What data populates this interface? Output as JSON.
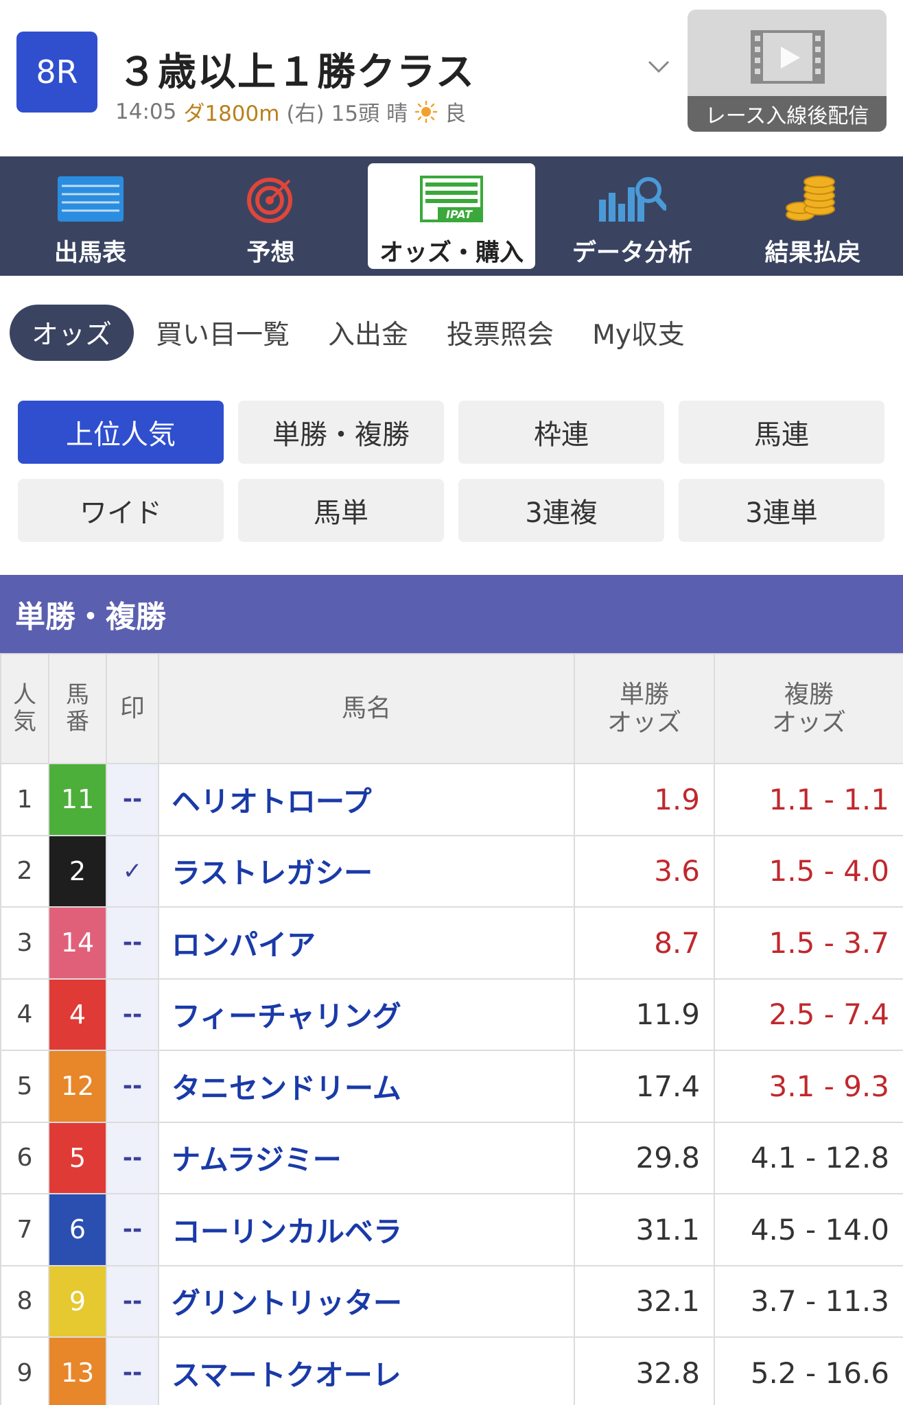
{
  "race": {
    "number": "8R",
    "title": "３歳以上１勝クラス",
    "time": "14:05",
    "track": "ダ1800m",
    "direction": "(右)",
    "runners": "15頭",
    "weather": "晴",
    "condition": "良"
  },
  "video": {
    "label": "レース入線後配信"
  },
  "main_nav": [
    {
      "label": "出馬表",
      "icon": "entry-list-icon"
    },
    {
      "label": "予想",
      "icon": "target-icon"
    },
    {
      "label": "オッズ・購入",
      "icon": "ipat-icon",
      "icon_text": "IPAT"
    },
    {
      "label": "データ分析",
      "icon": "chart-search-icon"
    },
    {
      "label": "結果払戻",
      "icon": "coins-icon"
    }
  ],
  "sub_nav": [
    "オッズ",
    "買い目一覧",
    "入出金",
    "投票照会",
    "My収支"
  ],
  "bet_types": [
    "上位人気",
    "単勝・複勝",
    "枠連",
    "馬連",
    "ワイド",
    "馬単",
    "3連複",
    "3連単"
  ],
  "section_title": "単勝・複勝",
  "table": {
    "headers": {
      "pop": [
        "人",
        "気"
      ],
      "num": [
        "馬",
        "番"
      ],
      "mark": "印",
      "name": "馬名",
      "win": [
        "単勝",
        "オッズ"
      ],
      "place": [
        "複勝",
        "オッズ"
      ]
    },
    "rows": [
      {
        "pop": "1",
        "num": "11",
        "num_color": "#4caf3a",
        "mark": "--",
        "name": "ヘリオトロープ",
        "win": "1.9",
        "win_red": true,
        "place": "1.1 - 1.1",
        "place_red": true
      },
      {
        "pop": "2",
        "num": "2",
        "num_color": "#1e1e1e",
        "mark": "✓",
        "name": "ラストレガシー",
        "win": "3.6",
        "win_red": true,
        "place": "1.5 - 4.0",
        "place_red": true
      },
      {
        "pop": "3",
        "num": "14",
        "num_color": "#e0607a",
        "mark": "--",
        "name": "ロンパイア",
        "win": "8.7",
        "win_red": true,
        "place": "1.5 - 3.7",
        "place_red": true
      },
      {
        "pop": "4",
        "num": "4",
        "num_color": "#e03a36",
        "mark": "--",
        "name": "フィーチャリング",
        "win": "11.9",
        "win_red": false,
        "place": "2.5 - 7.4",
        "place_red": true
      },
      {
        "pop": "5",
        "num": "12",
        "num_color": "#e8862a",
        "mark": "--",
        "name": "タニセンドリーム",
        "win": "17.4",
        "win_red": false,
        "place": "3.1 - 9.3",
        "place_red": true
      },
      {
        "pop": "6",
        "num": "5",
        "num_color": "#e03a36",
        "mark": "--",
        "name": "ナムラジミー",
        "win": "29.8",
        "win_red": false,
        "place": "4.1 - 12.8",
        "place_red": false
      },
      {
        "pop": "7",
        "num": "6",
        "num_color": "#2a4fb0",
        "mark": "--",
        "name": "コーリンカルベラ",
        "win": "31.1",
        "win_red": false,
        "place": "4.5 - 14.0",
        "place_red": false
      },
      {
        "pop": "8",
        "num": "9",
        "num_color": "#e6c830",
        "mark": "--",
        "name": "グリントリッター",
        "win": "32.1",
        "win_red": false,
        "place": "3.7 - 11.3",
        "place_red": false
      },
      {
        "pop": "9",
        "num": "13",
        "num_color": "#e8862a",
        "mark": "--",
        "name": "スマートクオーレ",
        "win": "32.8",
        "win_red": false,
        "place": "5.2 - 16.6",
        "place_red": false
      }
    ]
  }
}
